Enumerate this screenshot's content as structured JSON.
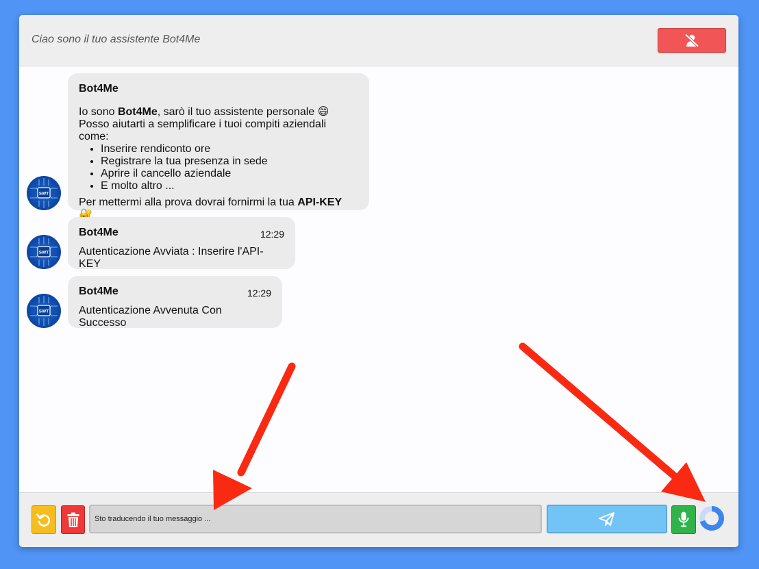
{
  "header": {
    "title": "Ciao sono il tuo assistente Bot4Me",
    "mute_icon": "user-slash-icon"
  },
  "messages": [
    {
      "sender": "Bot4Me",
      "intro_before": "Io sono ",
      "intro_bold": "Bot4Me",
      "intro_after": ", sarò il tuo assistente personale 😄",
      "line2": "Posso aiutarti a semplificare i tuoi compiti aziendali come:",
      "list": [
        "Inserire rendiconto ore",
        "Registrare la tua presenza in sede",
        "Aprire il cancello aziendale",
        "E molto altro ..."
      ],
      "closing_before": "Per mettermi alla prova dovrai fornirmi la tua ",
      "closing_bold": "API-KEY",
      "closing_after": " 🔐"
    },
    {
      "sender": "Bot4Me",
      "time": "12:29",
      "text": "Autenticazione Avviata : Inserire l'API-KEY"
    },
    {
      "sender": "Bot4Me",
      "time": "12:29",
      "text": "Autenticazione Avvenuta Con Successo"
    }
  ],
  "avatar_label": "SWT",
  "footer": {
    "input_value": "Sto traducendo il tuo messaggio ...",
    "undo_icon": "undo-icon",
    "delete_icon": "trash-icon",
    "send_icon": "paper-plane-icon",
    "mic_icon": "microphone-icon",
    "loading_icon": "loading-spinner-icon"
  },
  "colors": {
    "background": "#5094f6",
    "mute_button": "#f25555",
    "undo_button": "#f6bd1e",
    "delete_button": "#ef3939",
    "send_button": "#73c4f6",
    "mic_button": "#2fb34a",
    "bubble": "#ebebeb"
  }
}
